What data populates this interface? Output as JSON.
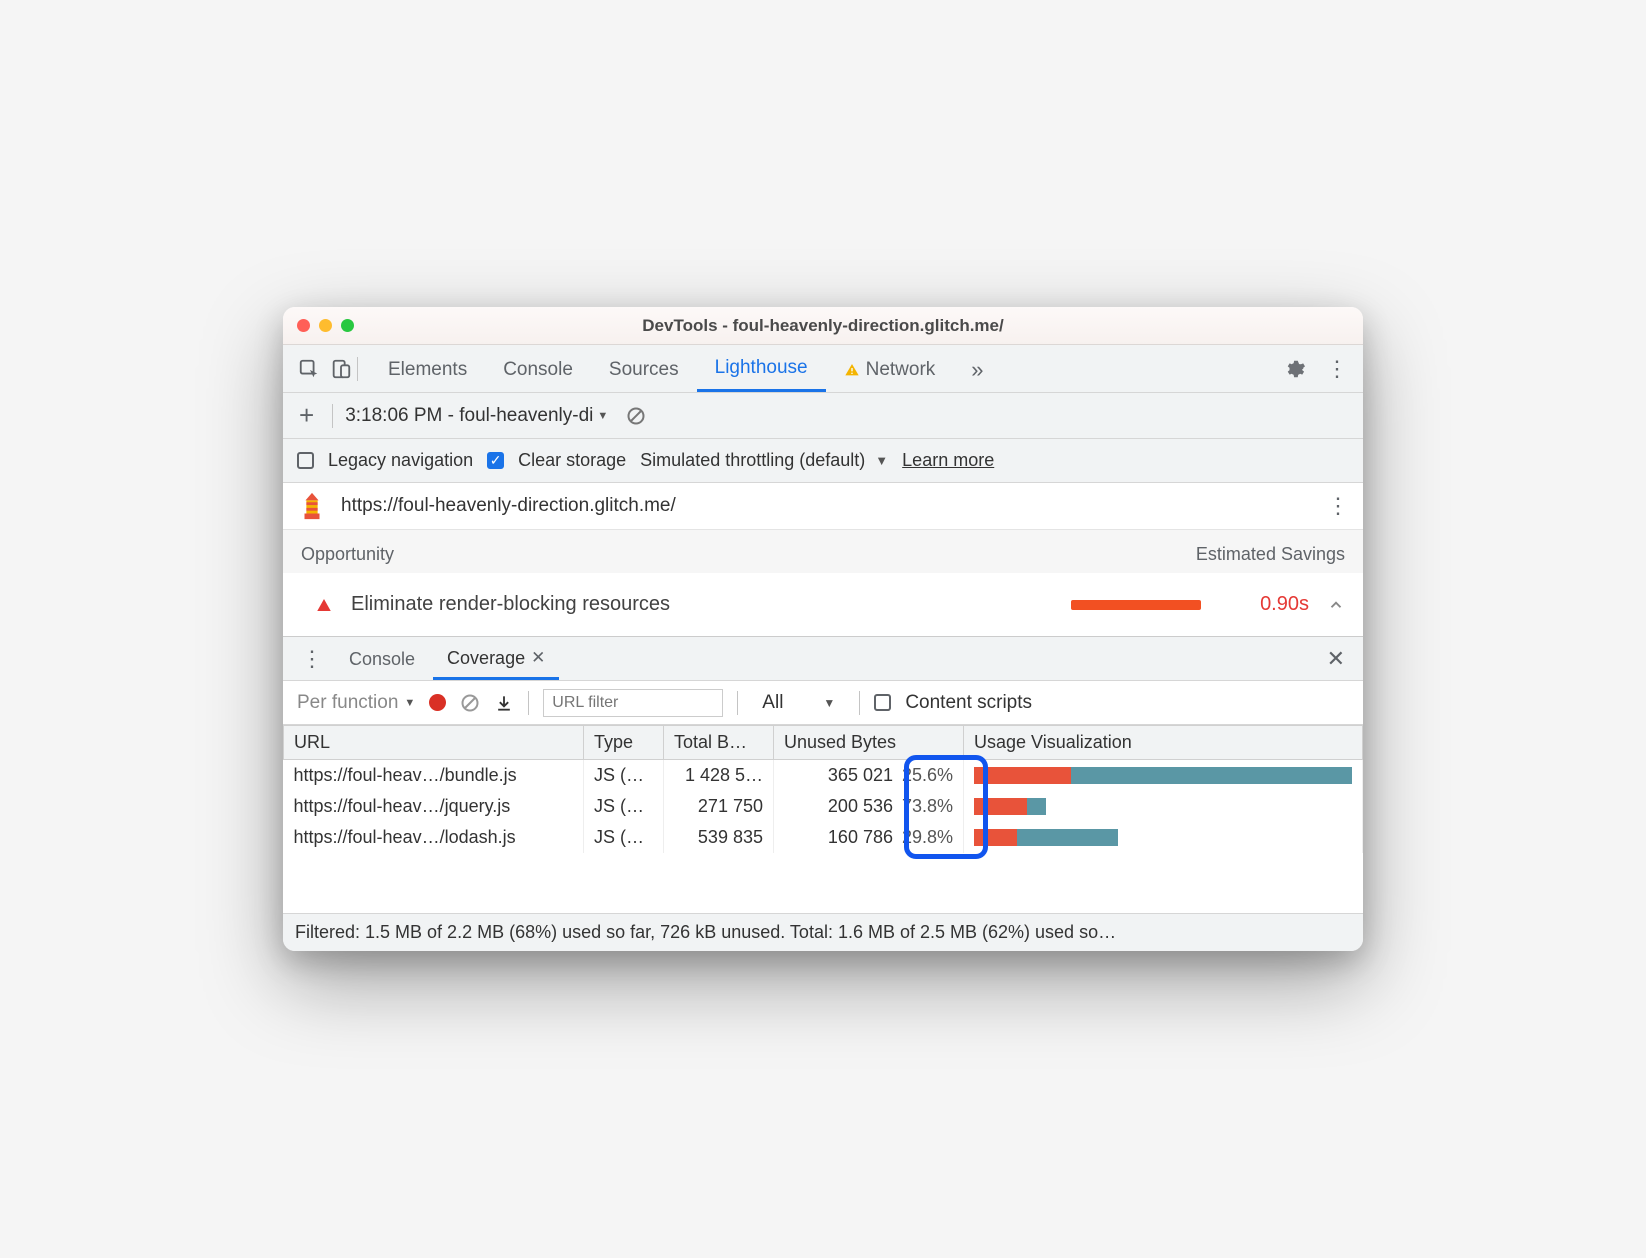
{
  "window": {
    "title": "DevTools - foul-heavenly-direction.glitch.me/"
  },
  "mainTabs": {
    "items": [
      "Elements",
      "Console",
      "Sources",
      "Lighthouse",
      "Network"
    ],
    "activeIndex": 3,
    "networkHasWarning": true
  },
  "reportBar": {
    "reportLabel": "3:18:06 PM - foul-heavenly-di"
  },
  "options": {
    "legacyNavLabel": "Legacy navigation",
    "legacyNavChecked": false,
    "clearStorageLabel": "Clear storage",
    "clearStorageChecked": true,
    "throttlingLabel": "Simulated throttling (default)",
    "learnMore": "Learn more"
  },
  "pageUrl": "https://foul-heavenly-direction.glitch.me/",
  "auditSection": {
    "leftHeader": "Opportunity",
    "rightHeader": "Estimated Savings",
    "audit": {
      "title": "Eliminate render-blocking resources",
      "savings": "0.90s"
    }
  },
  "drawer": {
    "tabs": [
      "Console",
      "Coverage"
    ],
    "activeIndex": 1
  },
  "coverageToolbar": {
    "granularity": "Per function",
    "filterPlaceholder": "URL filter",
    "typeFilter": "All",
    "contentScriptsLabel": "Content scripts",
    "contentScriptsChecked": false
  },
  "coverageTable": {
    "headers": {
      "url": "URL",
      "type": "Type",
      "total": "Total B…",
      "unused": "Unused Bytes",
      "viz": "Usage Visualization"
    },
    "rows": [
      {
        "url": "https://foul-heav…/bundle.js",
        "type": "JS (…",
        "total": "1 428 5…",
        "unusedBytes": "365 021",
        "unusedPct": "25.6%",
        "usedFrac": 0.256,
        "widthFrac": 1.0
      },
      {
        "url": "https://foul-heav…/jquery.js",
        "type": "JS (…",
        "total": "271 750",
        "unusedBytes": "200 536",
        "unusedPct": "73.8%",
        "usedFrac": 0.738,
        "widthFrac": 0.19
      },
      {
        "url": "https://foul-heav…/lodash.js",
        "type": "JS (…",
        "total": "539 835",
        "unusedBytes": "160 786",
        "unusedPct": "29.8%",
        "usedFrac": 0.298,
        "widthFrac": 0.38
      }
    ]
  },
  "statusBar": "Filtered: 1.5 MB of 2.2 MB (68%) used so far, 726 kB unused. Total: 1.6 MB of 2.5 MB (62%) used so…"
}
